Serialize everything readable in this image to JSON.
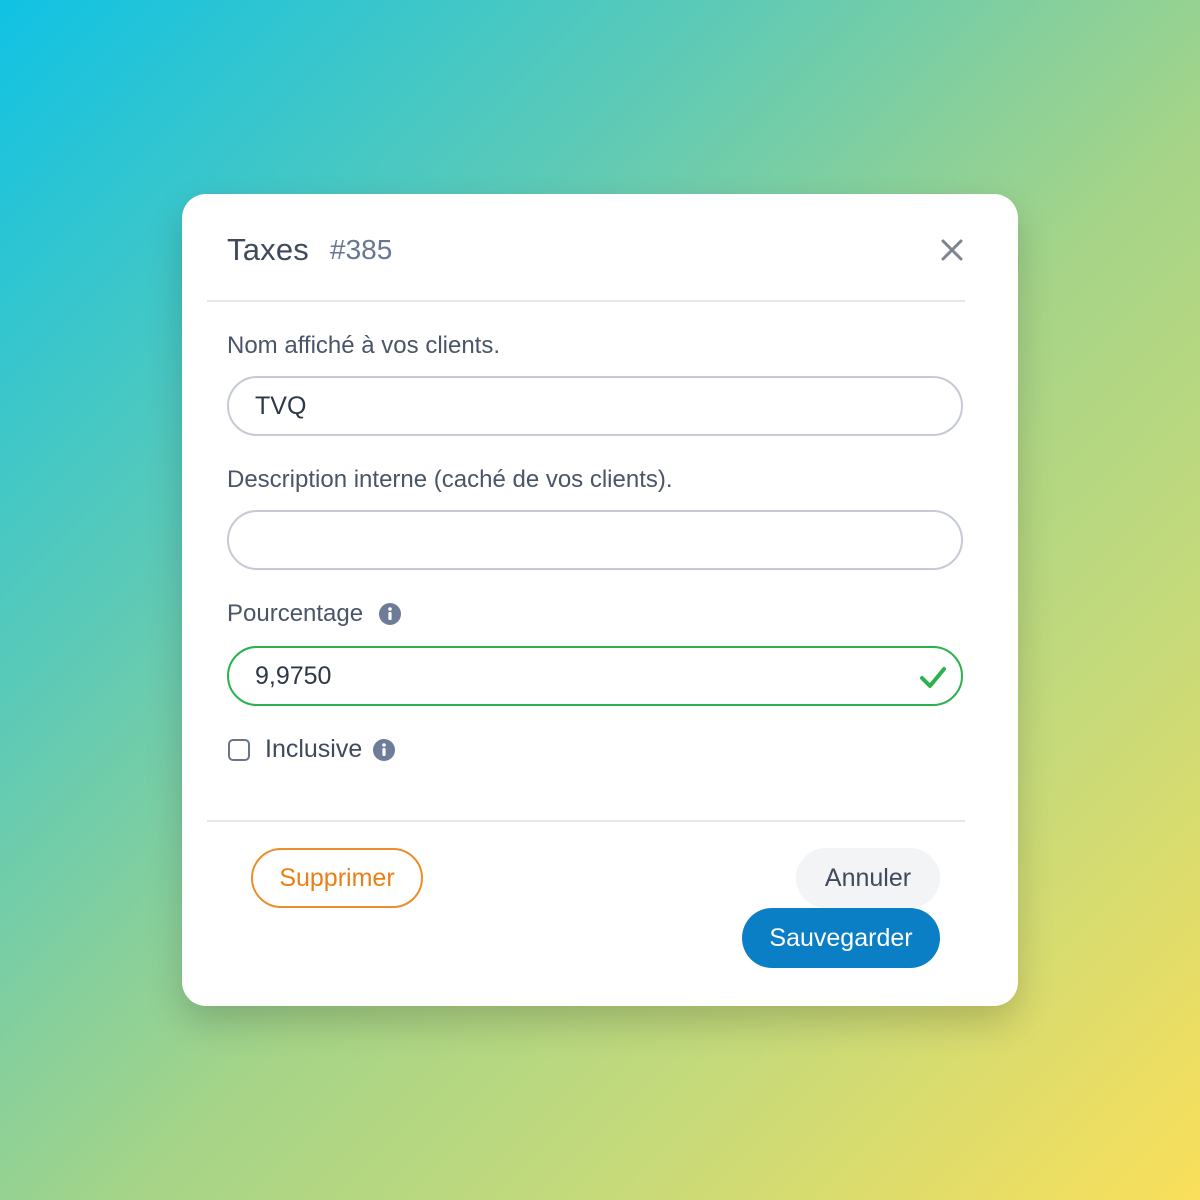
{
  "modal": {
    "title": "Taxes",
    "record_id": "#385",
    "close_icon": "close-icon"
  },
  "form": {
    "display_name": {
      "label": "Nom affiché à vos clients.",
      "value": "TVQ",
      "placeholder": ""
    },
    "internal_description": {
      "label": "Description interne (caché de vos clients).",
      "value": "",
      "placeholder": ""
    },
    "percentage": {
      "label": "Pourcentage",
      "value": "9,9750",
      "info_icon": "info-icon",
      "status_icon": "check-icon",
      "status": "valid"
    },
    "inclusive": {
      "label": "Inclusive",
      "checked": false,
      "info_icon": "info-icon"
    }
  },
  "actions": {
    "delete_label": "Supprimer",
    "cancel_label": "Annuler",
    "save_label": "Sauvegarder"
  },
  "colors": {
    "primary": "#0a7fc6",
    "danger_outline": "#ee8c2a",
    "valid_border": "#2bb24c",
    "text": "#3f4a5c",
    "muted": "#687692"
  }
}
